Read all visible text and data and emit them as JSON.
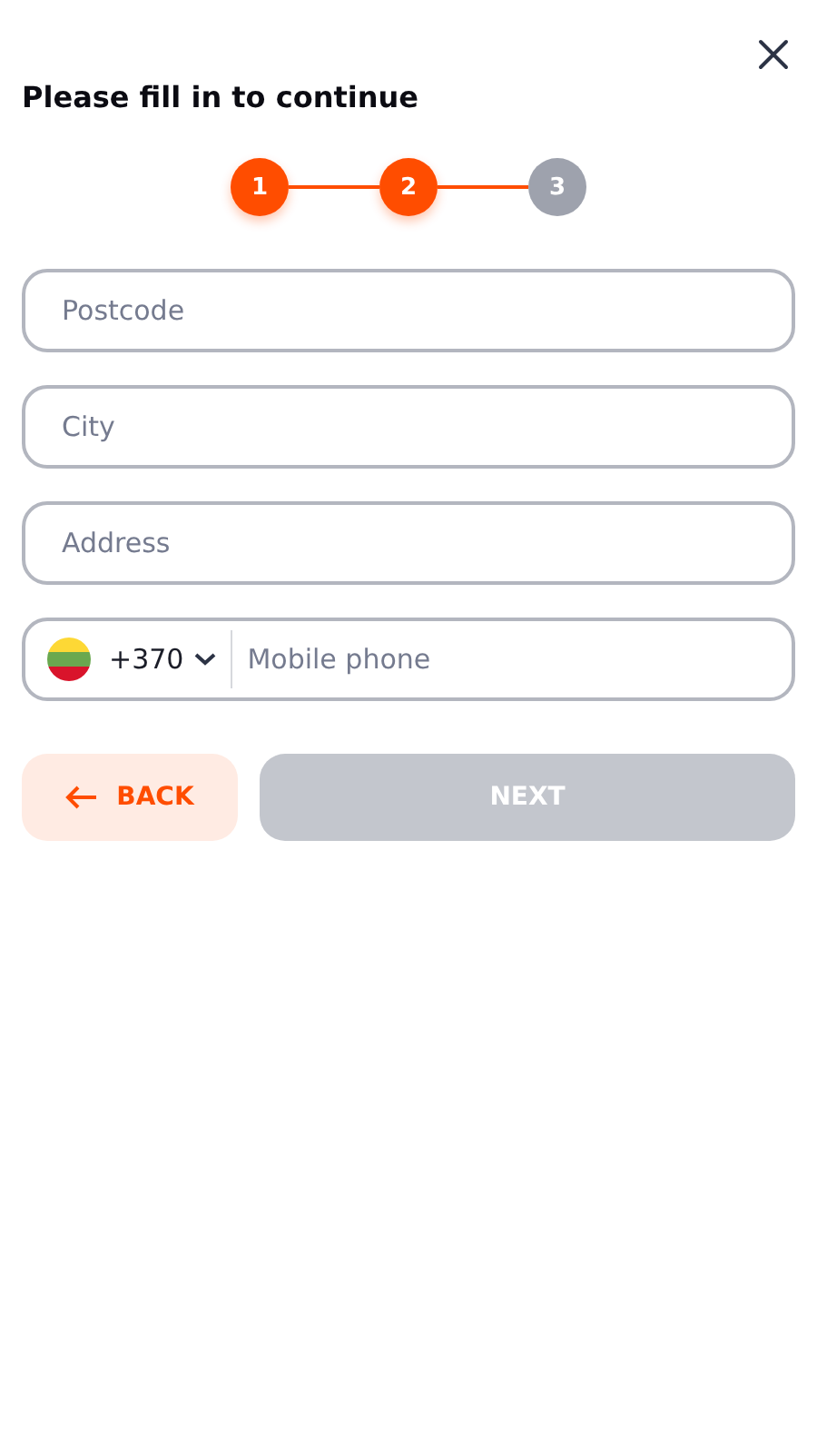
{
  "title": "Please fill in to continue",
  "steps": [
    {
      "label": "1",
      "done": true
    },
    {
      "label": "2",
      "done": true
    },
    {
      "label": "3",
      "done": false
    }
  ],
  "fields": [
    {
      "placeholder": "Postcode"
    },
    {
      "placeholder": "City"
    },
    {
      "placeholder": "Address"
    }
  ],
  "phone": {
    "code": "+370",
    "placeholder": "Mobile phone"
  },
  "back_button": {
    "label": "BACK"
  },
  "next_button": {
    "label": "NEXT",
    "disabled": true
  }
}
